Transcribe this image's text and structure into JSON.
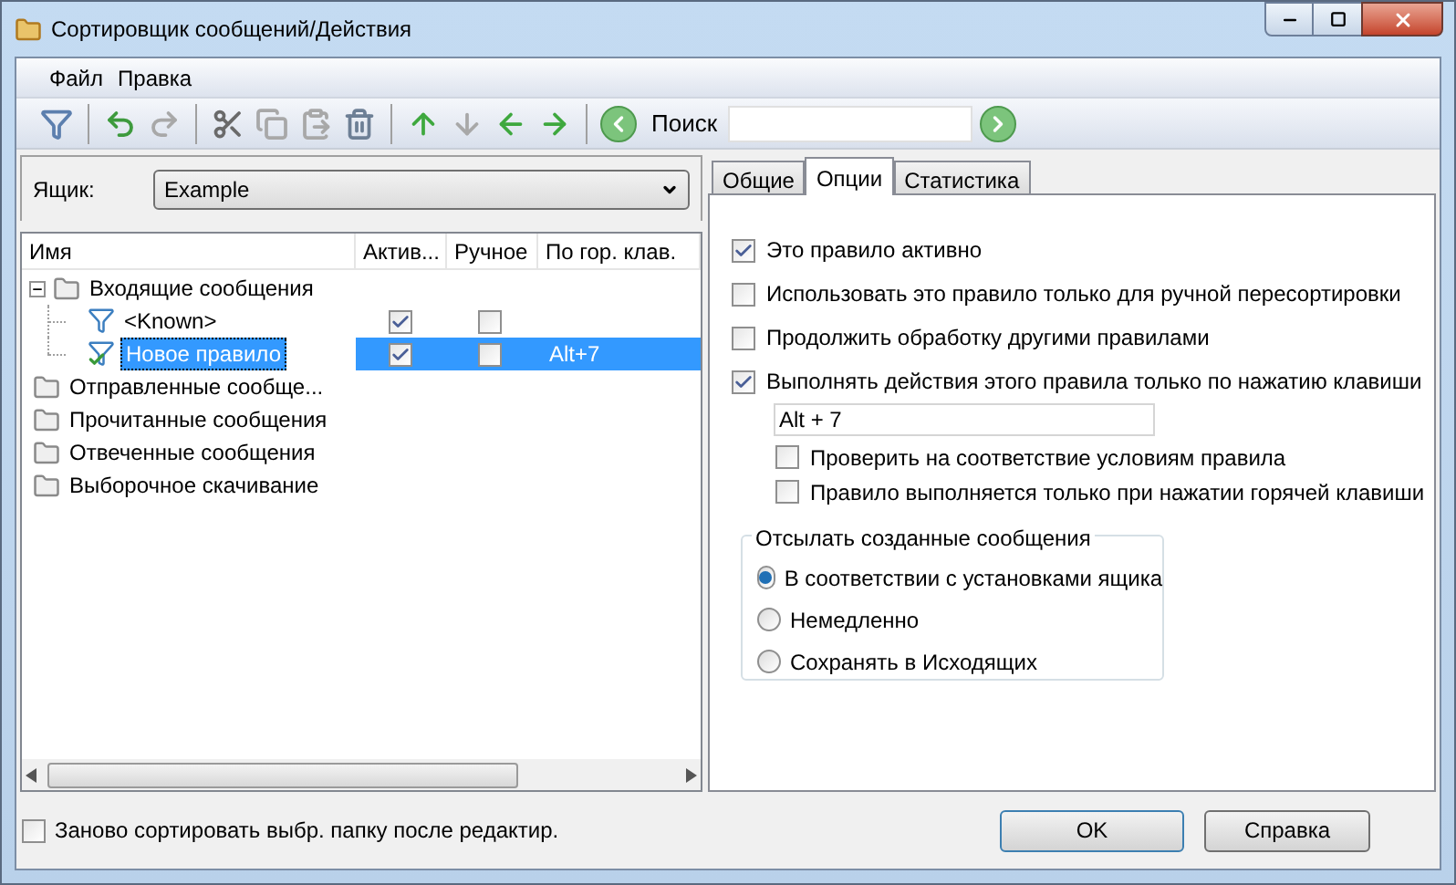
{
  "window": {
    "title": "Сортировщик сообщений/Действия"
  },
  "menu": [
    {
      "label": "Файл"
    },
    {
      "label": "Правка"
    }
  ],
  "toolbar": [
    {
      "kind": "add-filter",
      "disabled": false
    },
    {
      "kind": "sep"
    },
    {
      "kind": "undo",
      "disabled": false
    },
    {
      "kind": "redo",
      "disabled": true
    },
    {
      "kind": "sep"
    },
    {
      "kind": "cut",
      "disabled": false
    },
    {
      "kind": "copy",
      "disabled": true
    },
    {
      "kind": "paste",
      "disabled": true
    },
    {
      "kind": "delete",
      "disabled": false
    },
    {
      "kind": "sep"
    },
    {
      "kind": "up",
      "disabled": false
    },
    {
      "kind": "down",
      "disabled": true
    },
    {
      "kind": "left",
      "disabled": false
    },
    {
      "kind": "right",
      "disabled": false
    },
    {
      "kind": "sep"
    },
    {
      "kind": "back",
      "disabled": false
    }
  ],
  "search": {
    "label": "Поиск"
  },
  "mailbox": {
    "label": "Ящик:",
    "value": "Example"
  },
  "tree": {
    "columns": [
      "Имя",
      "Актив...",
      "Ручное",
      "По гор. клав."
    ],
    "items": [
      {
        "kind": "folder",
        "label": "Входящие сообщения",
        "expanded": true,
        "children": [
          {
            "kind": "rule",
            "label": "<Known>",
            "active": true,
            "manual": false,
            "selected": false
          },
          {
            "kind": "rule",
            "label": "Новое правило",
            "active": true,
            "manual": false,
            "hotkey": "Alt+7",
            "selected": true
          }
        ]
      },
      {
        "kind": "folder",
        "label": "Отправленные сообще..."
      },
      {
        "kind": "folder",
        "label": "Прочитанные сообщения"
      },
      {
        "kind": "folder",
        "label": "Отвеченные сообщения"
      },
      {
        "kind": "folder",
        "label": "Выборочное скачивание"
      }
    ]
  },
  "tabs": [
    {
      "label": "Общие",
      "selected": false
    },
    {
      "label": "Опции",
      "selected": true
    },
    {
      "label": "Статистика",
      "selected": false
    }
  ],
  "options": [
    {
      "label": "Это правило активно",
      "checked": true
    },
    {
      "label": "Использовать это правило только для ручной пересортировки",
      "checked": false
    },
    {
      "label": "Продолжить обработку другими правилами",
      "checked": false
    },
    {
      "label": "Выполнять действия этого правила только по нажатию клавиши",
      "checked": true
    }
  ],
  "hotkey_field": {
    "value": "Alt + 7"
  },
  "sub_options": [
    {
      "label": "Проверить на соответствие условиям правила",
      "checked": false
    },
    {
      "label": "Правило выполняется только при нажатии горячей клавиши",
      "checked": false
    }
  ],
  "send_group": {
    "title": "Отсылать созданные сообщения",
    "choices": [
      {
        "label": "В соответствии с установками ящика",
        "selected": true
      },
      {
        "label": "Немедленно",
        "selected": false
      },
      {
        "label": "Сохранять в Исходящих",
        "selected": false
      }
    ]
  },
  "resort_checkbox": {
    "label": "Заново сортировать выбр. папку после редактир.",
    "checked": false
  },
  "buttons": [
    "OK",
    "Справка"
  ]
}
